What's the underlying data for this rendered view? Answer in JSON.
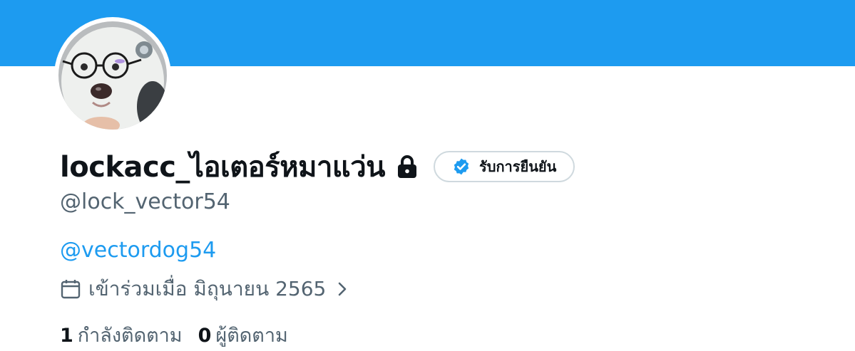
{
  "profile": {
    "display_name": "lockacc_ไอเตอร์หมาแว่น",
    "protected_icon": "lock-icon",
    "verify_button_label": "รับการยืนยัน",
    "verify_icon": "verified-badge-icon",
    "handle": "@lock_vector54",
    "bio_link": "@vectordog54",
    "joined_text": "เข้าร่วมเมื่อ มิถุนายน 2565",
    "joined_icon": "calendar-icon",
    "joined_chevron_icon": "chevron-right-icon"
  },
  "stats": {
    "following_count": "1",
    "following_label": "กำลังติดตาม",
    "followers_count": "0",
    "followers_label": "ผู้ติดตาม"
  },
  "colors": {
    "banner": "#1d9bf0",
    "link": "#1d9bf0",
    "secondary_text": "#536471",
    "primary_text": "#0f1419",
    "button_border": "#cfd9de"
  }
}
